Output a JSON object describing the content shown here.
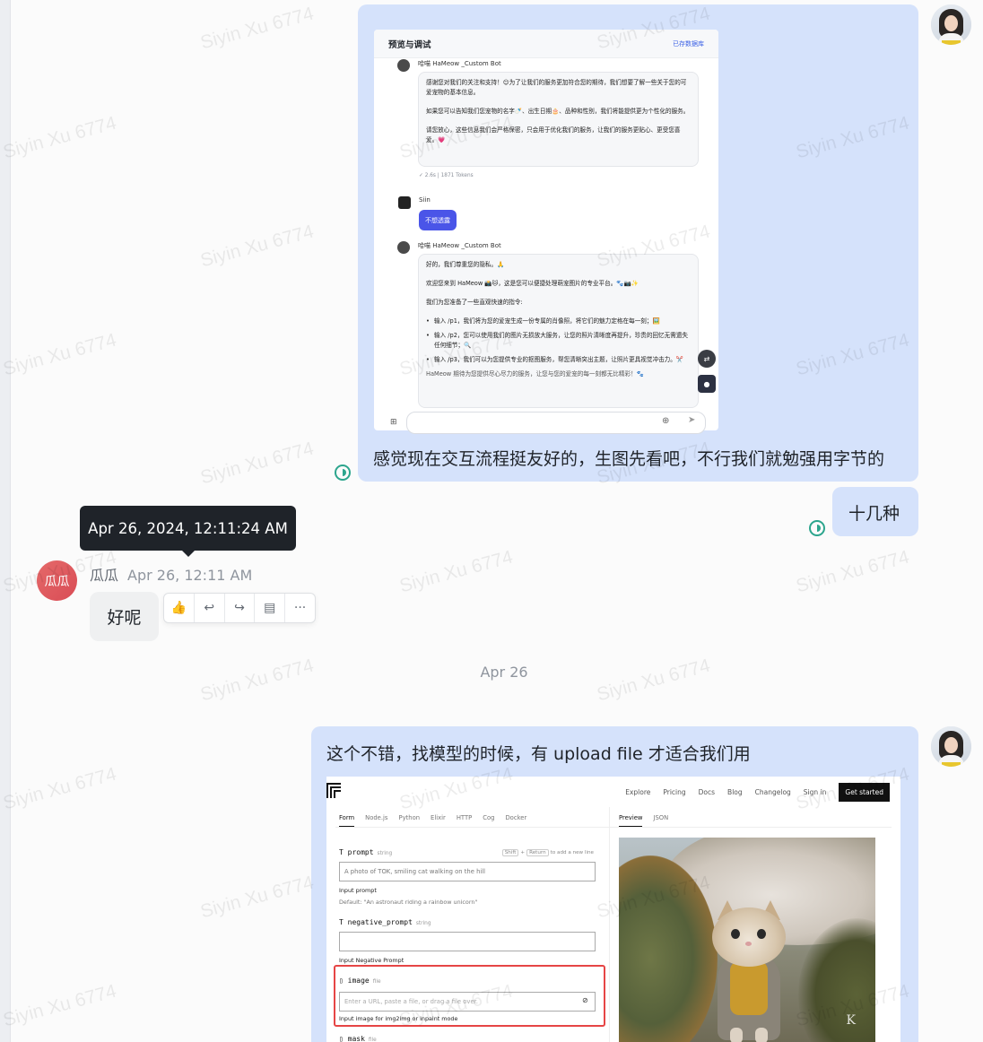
{
  "watermark_text": "Siyin Xu 6774",
  "screenshot1": {
    "header_title": "预览与调试",
    "header_right": "已存数据库",
    "bot_name": "哈喵 HaMeow _Custom Bot",
    "msg1": {
      "p1": "感谢您对我们的关注和支持！😊为了让我们的服务更加符合您的期待，我们想要了解一些关于您的可爱宠物的基本信息。",
      "p2": "如果您可以告知我们您宠物的名字🍼、出生日期🎂、品种和性别，我们将能提供更为个性化的服务。",
      "p3": "请您放心，这些信息我们会严格保密，只会用于优化我们的服务，让我们的服务更贴心、更受您喜爱。💗"
    },
    "meta": "✓ 2.6s  |  1871 Tokens",
    "user_name": "Siin",
    "user_msg": "不想透露",
    "msg2": {
      "p1": "好的，我们尊重您的隐私。🙏",
      "p2": "欢迎您来到 HaMeow 📸🐱，这是您可以便捷处理萌宠图片的专业平台。🐾📷✨",
      "p3": "我们为您准备了一些直观快速的指令:",
      "items": [
        "输入 /p1，我们将为您的爱宠生成一份专属的肖像照，将它们的魅力定格在每一刻；🖼️",
        "输入 /p2，您可以使用我们的图片无损放大服务，让您的照片清晰度再提升，珍贵的回忆无需遗失任何细节；🔍",
        "输入 /p3，我们可以为您提供专业的抠图服务，帮您清晰突出主题，让照片更具视觉冲击力。✂️"
      ],
      "p4": "HaMeow 期待为您提供尽心尽力的服务，让您与您的爱宠的每一刻都无比精彩！🐾"
    }
  },
  "msg_caption_1": "感觉现在交互流程挺友好的，生图先看吧，不行我们就勉强用字节的",
  "msg_me_2": "十几种",
  "tooltip": "Apr 26, 2024, 12:11:24 AM",
  "other": {
    "avatar_text": "瓜瓜",
    "name": "瓜瓜",
    "time": "Apr 26, 12:11 AM",
    "message": "好呢"
  },
  "date_separator": "Apr 26",
  "msg_me_3": "这个不错，找模型的时候，有 upload file 才适合我们用",
  "screenshot2": {
    "nav": [
      "Explore",
      "Pricing",
      "Docs",
      "Blog",
      "Changelog",
      "Sign in"
    ],
    "cta": "Get started",
    "tabs": [
      "Form",
      "Node.js",
      "Python",
      "Elixir",
      "HTTP",
      "Cog",
      "Docker"
    ],
    "preview_tabs": [
      "Preview",
      "JSON"
    ],
    "prompt_label": "prompt",
    "prompt_type": "string",
    "hint_k1": "Shift",
    "hint_k2": "Return",
    "hint_rest": "to add a new line",
    "prompt_value": "A photo of TOK, smiling cat walking on the hill",
    "prompt_help": "Input prompt",
    "prompt_default": "Default: \"An astronaut riding a rainbow unicorn\"",
    "neg_label": "negative_prompt",
    "neg_type": "string",
    "neg_help": "Input Negative Prompt",
    "image_label": "image",
    "image_type": "file",
    "image_placeholder": "Enter a URL, paste a file, or drag a file over.",
    "image_help": "Input image for img2img or inpaint mode",
    "mask_label": "mask",
    "mask_type": "file"
  },
  "colors": {
    "my_bubble": "#d5e2fb",
    "other_bubble": "#eff0f1",
    "status_green": "#2ca58d",
    "bot_purple": "#4a55e8",
    "highlight_red": "#e64545"
  }
}
